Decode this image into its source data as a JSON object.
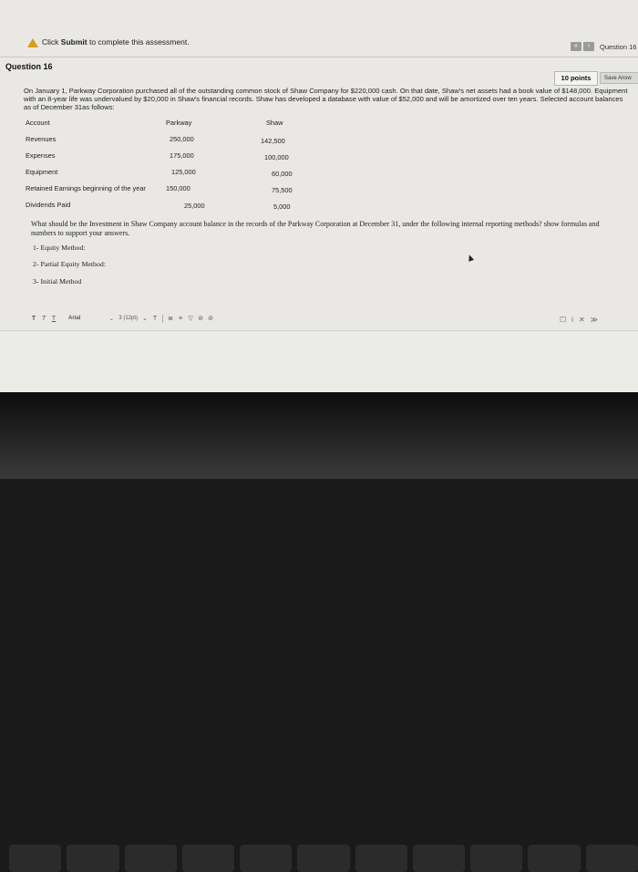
{
  "alert": {
    "prefix": "Click ",
    "bold": "Submit",
    "suffix": " to complete this assessment."
  },
  "nav": {
    "prev_label": "«",
    "back_label": "‹",
    "question_label": "Question 16 o"
  },
  "question": {
    "heading": "Question 16",
    "points": "10 points",
    "save_label": "Save Answ",
    "body": "On January 1, Parkway Corporation purchased all of the outstanding common stock of Shaw Company for $220,000 cash. On that date, Shaw's net assets had a book value of $148,000. Equipment with an 8-year life was undervalued by $20,000 in Shaw's financial records. Shaw has developed a database with value of $52,000 and will be amortized over ten years. Selected account balances as of December 31as follows:"
  },
  "table": {
    "headers": [
      "Account",
      "Parkway",
      "Shaw"
    ],
    "rows": [
      [
        "Revenues",
        "250,000",
        "142,500"
      ],
      [
        "Expenses",
        "175,000",
        "100,000"
      ],
      [
        "Equipment",
        "125,000",
        "60,000"
      ],
      [
        "Retained Earnings beginning of the year",
        "150,000",
        "75,500"
      ],
      [
        "Dividends Paid",
        "25,000",
        "5,000"
      ]
    ]
  },
  "prompt": "What should be the Investment in Shaw Company account balance in the records of the Parkway Corporation at December 31, under the following internal reporting methods? show formulas and numbers to support your answers.",
  "methods": [
    "1- Equity Method:",
    "2- Partial Equity Method:",
    "3- Initial Method"
  ],
  "editor": {
    "font": "Arial",
    "size": "3 (12pt)",
    "tools": [
      "T",
      "T",
      "T"
    ],
    "tools2": [
      "T",
      "≣",
      "≡",
      "▽",
      "⊘",
      "⊘"
    ],
    "right_tools": [
      "☐",
      "i",
      "✕",
      "≫"
    ]
  },
  "keyboard": {
    "keys": [
      "",
      "",
      "",
      "",
      "",
      "",
      "",
      "",
      "",
      "",
      ""
    ]
  }
}
